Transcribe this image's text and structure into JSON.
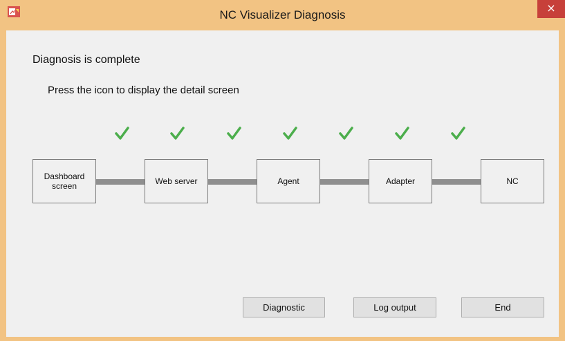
{
  "window": {
    "title": "NC Visualizer Diagnosis",
    "close_label": "×",
    "accent_color": "#f2c383",
    "close_color": "#c7403a"
  },
  "status_text": "Diagnosis is complete",
  "hint_text": "Press the icon to display the detail screen",
  "check_color": "#4cae4c",
  "nodes": [
    {
      "label": "Dashboard\nscreen"
    },
    {
      "label": "Web server"
    },
    {
      "label": "Agent"
    },
    {
      "label": "Adapter"
    },
    {
      "label": "NC"
    }
  ],
  "checks": [
    "ok",
    "ok",
    "ok",
    "ok",
    "ok",
    "ok",
    "ok"
  ],
  "buttons": {
    "diagnostic": "Diagnostic",
    "log_output": "Log output",
    "end": "End"
  }
}
